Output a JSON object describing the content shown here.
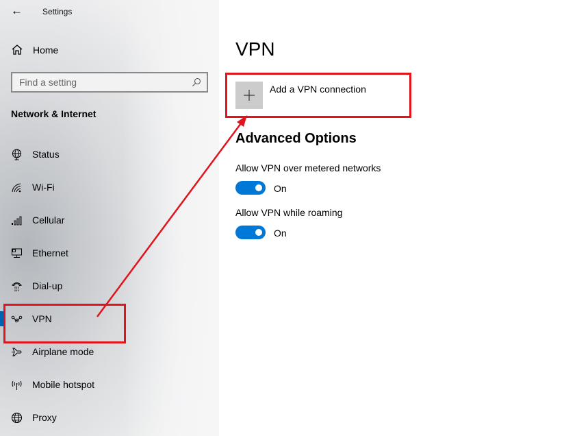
{
  "window": {
    "title": "Settings",
    "back_icon": "back-arrow-icon"
  },
  "sidebar": {
    "home_label": "Home",
    "search": {
      "placeholder": "Find a setting",
      "value": ""
    },
    "section_title": "Network & Internet",
    "items": [
      {
        "label": "Status",
        "icon": "globe-monitor-icon",
        "selected": false
      },
      {
        "label": "Wi-Fi",
        "icon": "wifi-icon",
        "selected": false
      },
      {
        "label": "Cellular",
        "icon": "cellular-signal-icon",
        "selected": false
      },
      {
        "label": "Ethernet",
        "icon": "ethernet-icon",
        "selected": false
      },
      {
        "label": "Dial-up",
        "icon": "phone-icon",
        "selected": false
      },
      {
        "label": "VPN",
        "icon": "vpn-icon",
        "selected": true
      },
      {
        "label": "Airplane mode",
        "icon": "airplane-icon",
        "selected": false
      },
      {
        "label": "Mobile hotspot",
        "icon": "hotspot-icon",
        "selected": false
      },
      {
        "label": "Proxy",
        "icon": "globe-icon",
        "selected": false
      }
    ]
  },
  "main": {
    "title": "VPN",
    "add_connection_label": "Add a VPN connection",
    "advanced_title": "Advanced Options",
    "options": [
      {
        "label": "Allow VPN over metered networks",
        "state": "On",
        "enabled": true
      },
      {
        "label": "Allow VPN while roaming",
        "state": "On",
        "enabled": true
      }
    ]
  },
  "colors": {
    "accent": "#0078d7",
    "annotation": "#e0141c",
    "selection_indicator": "#0063b1"
  }
}
